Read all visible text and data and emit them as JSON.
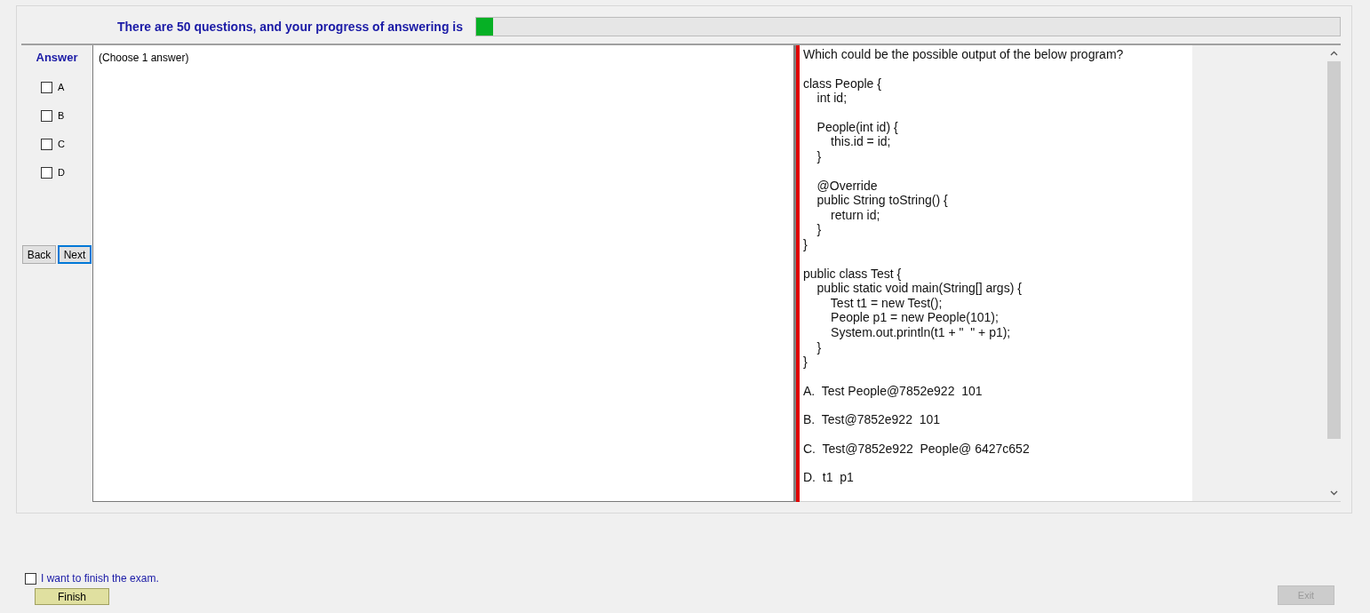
{
  "header": {
    "text": "There are 50 questions, and your progress of answering is",
    "progress": {
      "level": 0.02
    }
  },
  "answer_panel": {
    "title": "Answer",
    "options": [
      {
        "label": "A",
        "checked": false
      },
      {
        "label": "B",
        "checked": false
      },
      {
        "label": "C",
        "checked": false
      },
      {
        "label": "D",
        "checked": false
      }
    ],
    "buttons": [
      {
        "label": "Back",
        "focused": false
      },
      {
        "label": "Next",
        "focused": true
      }
    ]
  },
  "answer_box": {
    "hint": "(Choose 1 answer)"
  },
  "question": {
    "blocks": [
      [
        "Which could be the possible output of the below program?"
      ],
      [
        "class People {",
        "    int id;"
      ],
      [
        "    People(int id) {",
        "        this.id = id;",
        "    }"
      ],
      [
        "    @Override",
        "    public String toString() {",
        "        return id;",
        "    }",
        "}"
      ],
      [
        "public class Test {",
        "    public static void main(String[] args) {",
        "        Test t1 = new Test();",
        "        People p1 = new People(101);",
        "        System.out.println(t1 + \"  \" + p1);",
        "    }",
        "}"
      ],
      [
        "A.  Test People@7852e922  101"
      ],
      [
        "B.  Test@7852e922  101"
      ],
      [
        "C.  Test@7852e922  People@ 6427c652"
      ],
      [
        "D.  t1  p1"
      ]
    ]
  },
  "finish": {
    "label": "I want to finish the exam.",
    "checked": false,
    "button": "Finish"
  },
  "exit_button": {
    "label": "Exit",
    "disabled": true
  }
}
